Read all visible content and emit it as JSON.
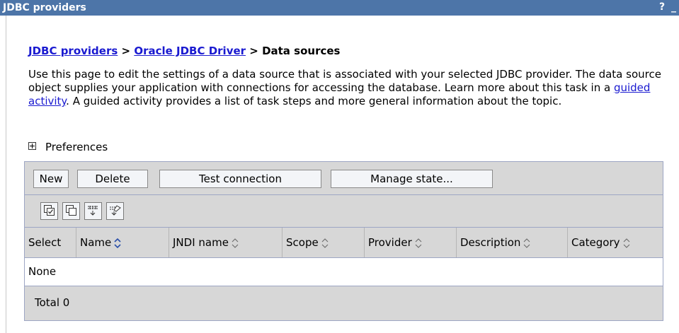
{
  "window": {
    "title": "JDBC providers",
    "help_label": "?",
    "minimize_label": "_"
  },
  "breadcrumb": {
    "item1": "JDBC providers",
    "sep1": " > ",
    "item2": "Oracle JDBC Driver",
    "sep2": " > ",
    "current": "Data sources"
  },
  "description": {
    "before_link": "Use this page to edit the settings of a data source that is associated with your selected JDBC provider. The data source object supplies your application with connections for accessing the database. Learn more about this task in a ",
    "link": "guided activity",
    "after_link": ". A guided activity provides a list of task steps and more general information about the topic."
  },
  "preferences": {
    "label": "Preferences"
  },
  "toolbar": {
    "new": "New",
    "delete": "Delete",
    "test_connection": "Test connection",
    "manage_state": "Manage state..."
  },
  "icon_toolbar": [
    "select-all-icon",
    "deselect-all-icon",
    "show-filter-icon",
    "clear-filter-icon"
  ],
  "table": {
    "columns": [
      "Select",
      "Name",
      "JNDI name",
      "Scope",
      "Provider",
      "Description",
      "Category"
    ],
    "empty_text": "None",
    "total_text": "Total 0"
  },
  "colors": {
    "titlebar": "#4d75a8",
    "link": "#1a1ad0",
    "panel_bg": "#d7d7d7",
    "border": "#9da6c4"
  }
}
